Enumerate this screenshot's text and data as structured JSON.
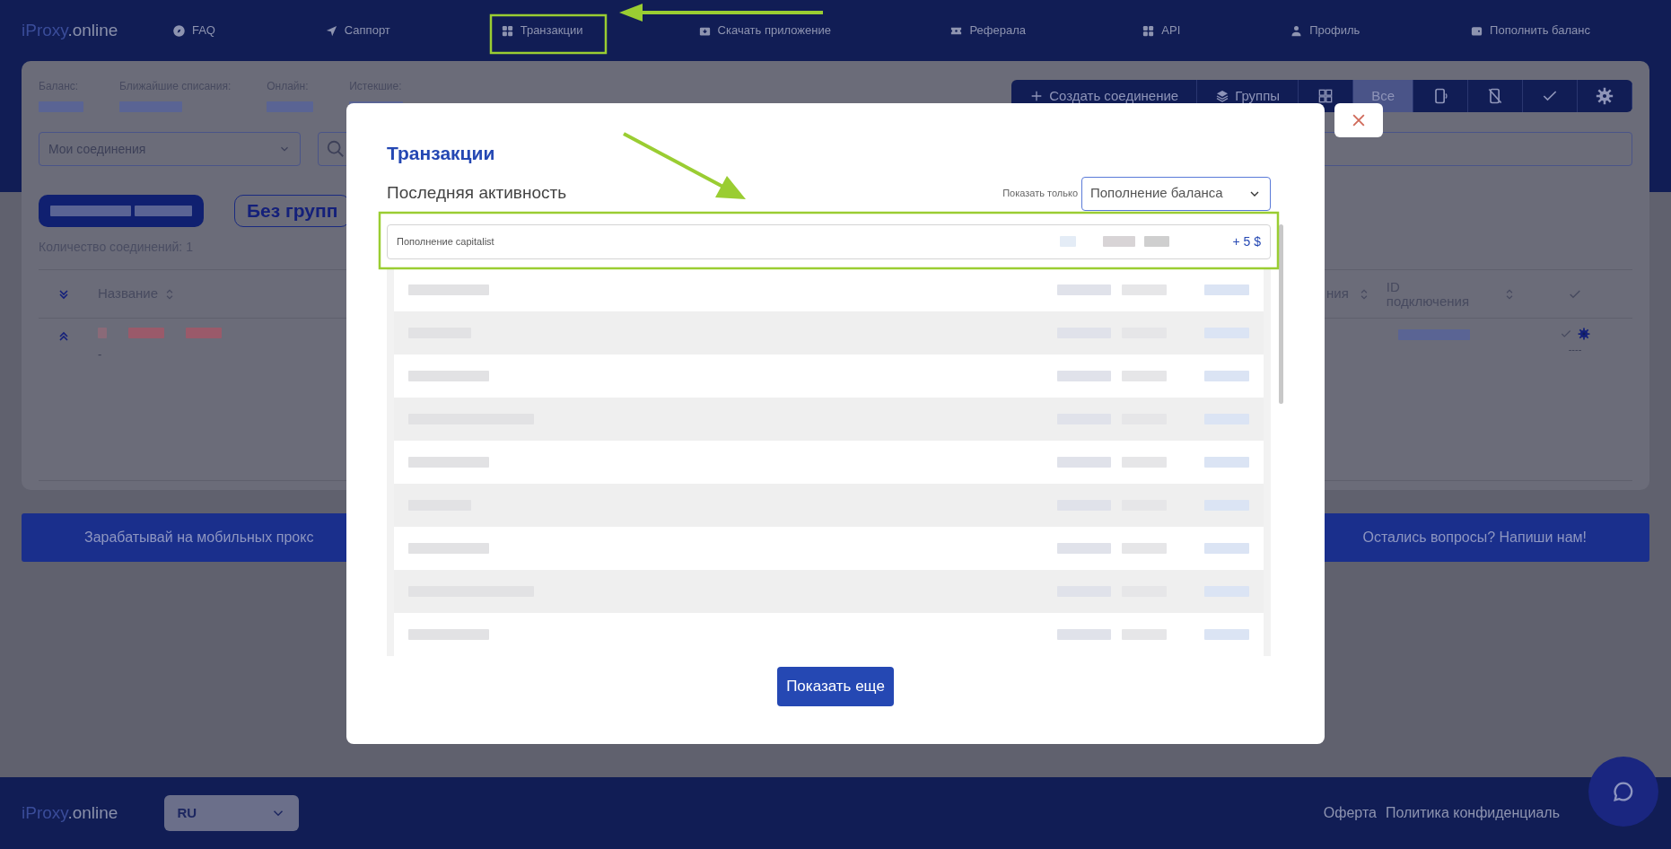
{
  "nav": {
    "logo": {
      "brand": "iProxy",
      "domain": ".online"
    },
    "items": [
      {
        "label": "FAQ"
      },
      {
        "label": "Саппорт"
      },
      {
        "label": "Транзакции"
      },
      {
        "label": "Скачать приложение"
      },
      {
        "label": "Реферала"
      },
      {
        "label": "API"
      },
      {
        "label": "Профиль"
      },
      {
        "label": "Пополнить баланс"
      }
    ]
  },
  "stats": [
    {
      "label": "Баланс:"
    },
    {
      "label": "Ближайшие списания:"
    },
    {
      "label": "Онлайн:"
    },
    {
      "label": "Истекшие:"
    }
  ],
  "toolbar": [
    {
      "kind": "text",
      "label": "Создать соединение",
      "selected": false
    },
    {
      "kind": "text",
      "label": "Группы",
      "selected": false
    },
    {
      "kind": "icon",
      "selected": false
    },
    {
      "kind": "text",
      "label": "Все",
      "selected": true
    },
    {
      "kind": "icon",
      "selected": false
    },
    {
      "kind": "icon",
      "selected": false
    },
    {
      "kind": "icon",
      "selected": false
    },
    {
      "kind": "icon",
      "selected": false
    }
  ],
  "connections_select": {
    "value": "Мои соединения"
  },
  "group_chip": "Без групп",
  "count": "Количество соединений: 1",
  "table": {
    "columns": [
      "Название",
      "ния",
      "ID подключения"
    ],
    "row": {
      "expanded": true,
      "note": "-",
      "dashes": "----"
    }
  },
  "banner": {
    "left": "Зарабатывай на мобильных прокс",
    "right": "Остались вопросы? Напиши нам!"
  },
  "footer": {
    "logo": {
      "brand": "iProxy",
      "domain": ".online"
    },
    "language": "RU",
    "links": [
      "Оферта",
      "Политика конфиденциаль"
    ]
  },
  "modal": {
    "title": "Транзакции",
    "subtitle": "Последняя активность",
    "filter_label": "Показать только",
    "filter_value": "Пополнение баланса",
    "transactions": [
      {
        "label": "Пополнение capitalist",
        "amount": "+ 5 $"
      }
    ],
    "more_button": "Показать еще"
  }
}
